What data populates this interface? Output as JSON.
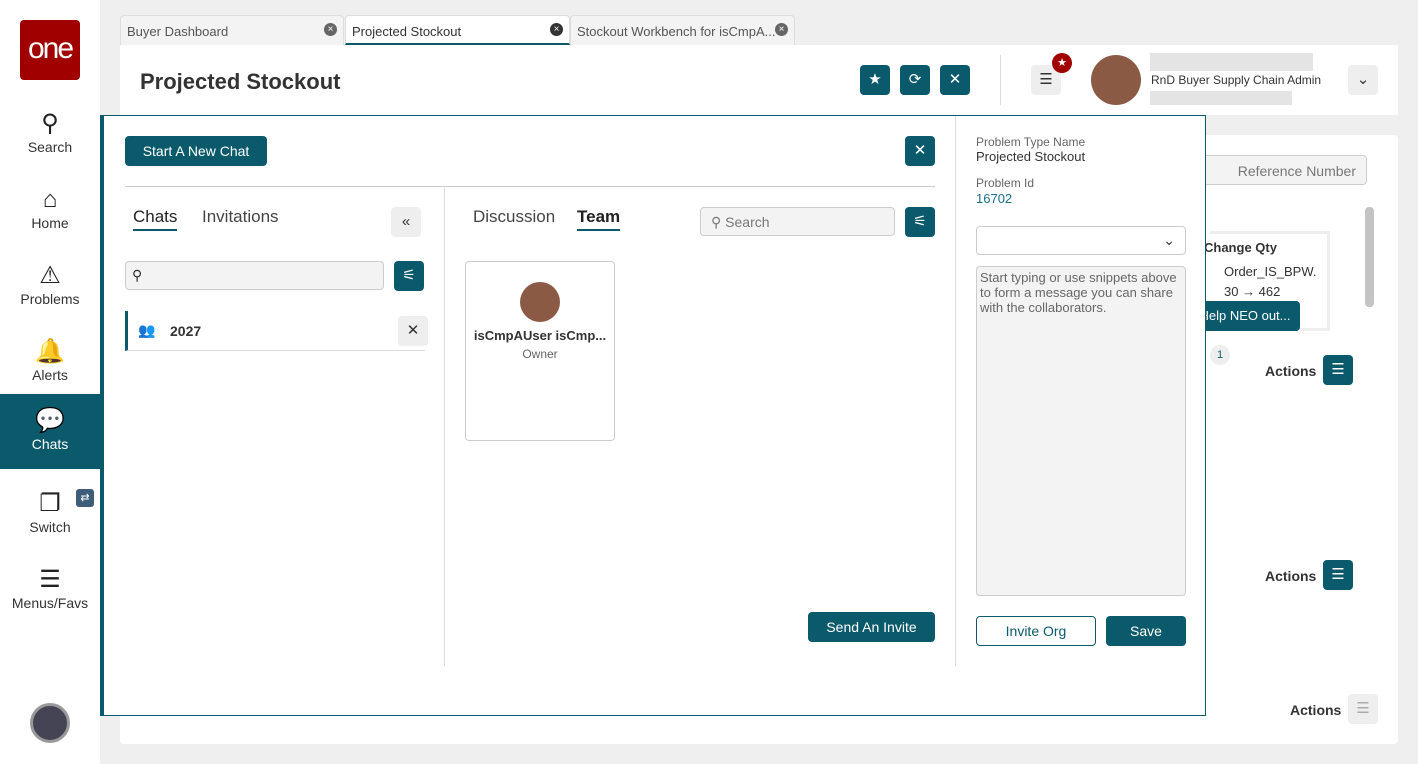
{
  "sidebar": {
    "logo": "one",
    "items": [
      {
        "label": "Search",
        "icon": "search-icon"
      },
      {
        "label": "Home",
        "icon": "home-icon"
      },
      {
        "label": "Problems",
        "icon": "warning-icon"
      },
      {
        "label": "Alerts",
        "icon": "bell-icon"
      },
      {
        "label": "Chats",
        "icon": "chat-icon"
      },
      {
        "label": "Switch",
        "icon": "switch-icon"
      },
      {
        "label": "Menus/Favs",
        "icon": "menu-icon"
      }
    ]
  },
  "tabs": [
    {
      "label": "Buyer Dashboard"
    },
    {
      "label": "Projected Stockout"
    },
    {
      "label": "Stockout Workbench for isCmpA..."
    }
  ],
  "header": {
    "title": "Projected Stockout",
    "user_role": "RnD Buyer Supply Chain Admin"
  },
  "background": {
    "search_placeholder": "Reference Number",
    "alert_title": "Change Qty",
    "alert_line1": "Order_IS_BPW.",
    "alert_line2": "30 → 462",
    "help_button": "Help NEO out...",
    "badge_count": "1",
    "actions_label": "Actions"
  },
  "chat": {
    "start_new": "Start A New Chat",
    "tabs": {
      "chats": "Chats",
      "invitations": "Invitations"
    },
    "chat_items": [
      {
        "name": "2027"
      }
    ],
    "subtabs": {
      "discussion": "Discussion",
      "team": "Team"
    },
    "search_placeholder": "Search",
    "member": {
      "name": "isCmpAUser isCmp...",
      "role": "Owner"
    },
    "send_invite": "Send An Invite"
  },
  "details": {
    "problem_type_label": "Problem Type Name",
    "problem_type": "Projected Stockout",
    "problem_id_label": "Problem Id",
    "problem_id": "16702",
    "message_placeholder": "Start typing or use snippets above to form a message you can share with the collaborators.",
    "invite_org": "Invite Org",
    "save": "Save"
  }
}
